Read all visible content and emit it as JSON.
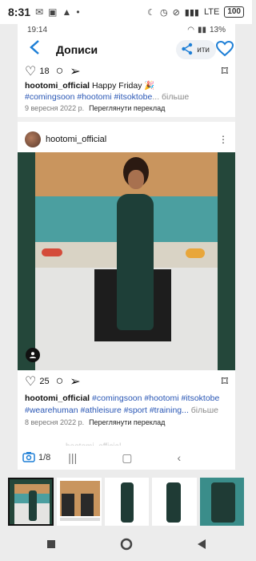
{
  "status": {
    "time": "8:31",
    "network": "LTE",
    "battery": "100"
  },
  "inner_status": {
    "time": "19:14",
    "battery": "13%"
  },
  "header": {
    "title": "Дописи",
    "share_label": "ити"
  },
  "post1": {
    "likes": "18",
    "user": "hootomi_official",
    "text": " Happy Friday 🎉",
    "tags": "#comingsoon #hootomi #itsoktobe",
    "more": "... більше",
    "date": "9 вересня 2022 р.",
    "translate": "Переглянути переклад"
  },
  "post2": {
    "user": "hootomi_official",
    "likes": "25",
    "tags_line1": "#comingsoon #hootomi #itsoktobe",
    "tags_line2": "#wearehuman #athleisure #sport #training...",
    "more": " більше",
    "date": "8 вересня 2022 р.",
    "translate": "Переглянути переклад",
    "next_user": "hootomi_official"
  },
  "pager": {
    "label": "1/8"
  },
  "colors": {
    "hashtag": "#2a57b5",
    "accent": "#1e7fd6",
    "photo_bg": "#24473a"
  }
}
